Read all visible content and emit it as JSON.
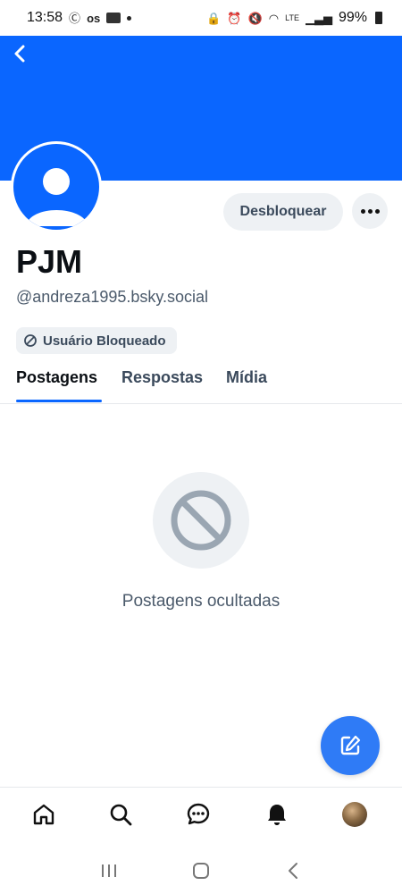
{
  "status_bar": {
    "time": "13:58",
    "battery": "99%",
    "left_icons": [
      "os-icon",
      "screen-record-icon",
      "notification-dot"
    ],
    "right_icons": [
      "lock-icon",
      "alarm-icon",
      "mute-icon",
      "wifi-icon",
      "volte-icon",
      "signal-icon",
      "battery-icon"
    ]
  },
  "colors": {
    "banner": "#0a66ff",
    "accent": "#2f7bf6",
    "chip_bg": "#eef1f4",
    "muted_text": "#4b5a6b"
  },
  "profile": {
    "display_name": "PJM",
    "handle": "@andreza1995.bsky.social",
    "blocked_label": "Usuário Bloqueado",
    "unblock_label": "Desbloquear"
  },
  "tabs": [
    {
      "label": "Postagens",
      "active": true
    },
    {
      "label": "Respostas",
      "active": false
    },
    {
      "label": "Mídia",
      "active": false
    }
  ],
  "empty_state": {
    "message": "Postagens ocultadas",
    "icon": "block-icon"
  },
  "bottom_nav": [
    "home-icon",
    "search-icon",
    "chat-icon",
    "bell-icon",
    "profile-avatar"
  ],
  "system_nav": [
    "recents-icon",
    "home-button-icon",
    "back-icon"
  ]
}
